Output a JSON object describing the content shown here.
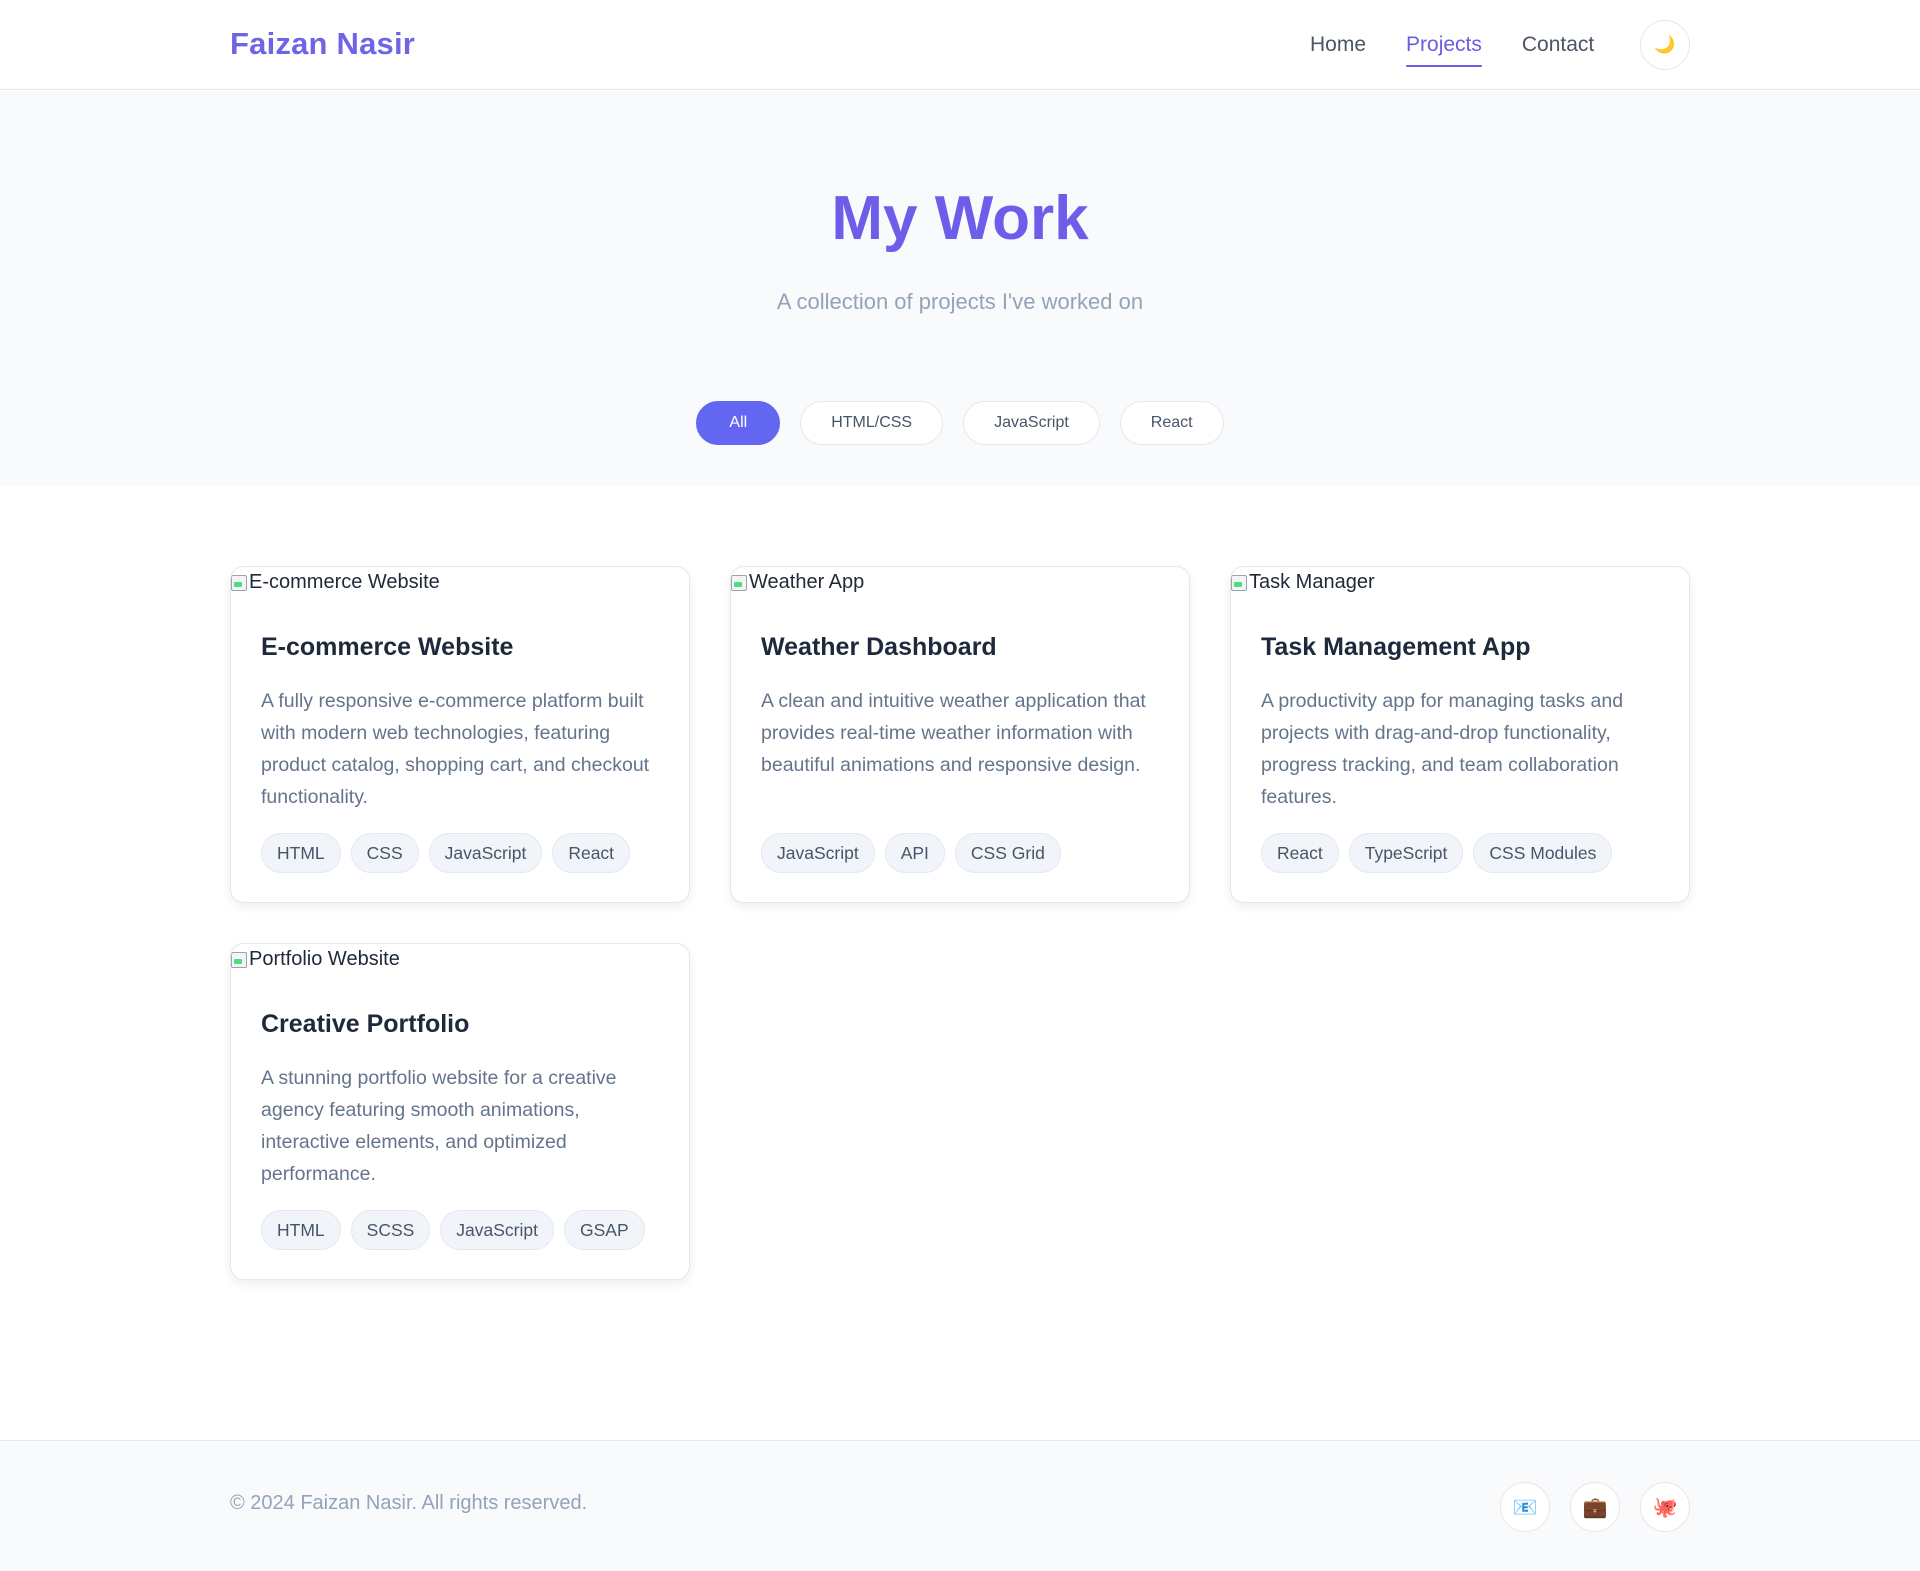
{
  "header": {
    "brand": "Faizan Nasir",
    "nav": [
      {
        "label": "Home",
        "active": false
      },
      {
        "label": "Projects",
        "active": true
      },
      {
        "label": "Contact",
        "active": false
      }
    ],
    "theme_toggle_icon": "moon-icon",
    "theme_toggle_glyph": "🌙"
  },
  "hero": {
    "title": "My Work",
    "subtitle": "A collection of projects I've worked on",
    "filters": [
      "All",
      "HTML/CSS",
      "JavaScript",
      "React"
    ],
    "active_filter": "All"
  },
  "projects": [
    {
      "image_alt": "E-commerce Website",
      "title": "E-commerce Website",
      "description": "A fully responsive e-commerce platform built with modern web technologies, featuring product catalog, shopping cart, and checkout functionality.",
      "tags": [
        "HTML",
        "CSS",
        "JavaScript",
        "React"
      ]
    },
    {
      "image_alt": "Weather App",
      "title": "Weather Dashboard",
      "description": "A clean and intuitive weather application that provides real-time weather information with beautiful animations and responsive design.",
      "tags": [
        "JavaScript",
        "API",
        "CSS Grid"
      ]
    },
    {
      "image_alt": "Task Manager",
      "title": "Task Management App",
      "description": "A productivity app for managing tasks and projects with drag-and-drop functionality, progress tracking, and team collaboration features.",
      "tags": [
        "React",
        "TypeScript",
        "CSS Modules"
      ]
    },
    {
      "image_alt": "Portfolio Website",
      "title": "Creative Portfolio",
      "description": "A stunning portfolio website for a creative agency featuring smooth animations, interactive elements, and optimized performance.",
      "tags": [
        "HTML",
        "SCSS",
        "JavaScript",
        "GSAP"
      ]
    }
  ],
  "footer": {
    "copyright": "© 2024 Faizan Nasir. All rights reserved.",
    "socials": [
      {
        "icon": "email-icon",
        "glyph": "📧"
      },
      {
        "icon": "briefcase-icon",
        "glyph": "💼"
      },
      {
        "icon": "octopus-icon",
        "glyph": "🐙"
      }
    ]
  },
  "colors": {
    "brand": "#7064e6",
    "accent": "#6366f1",
    "active_nav": "#6a5ee0"
  }
}
